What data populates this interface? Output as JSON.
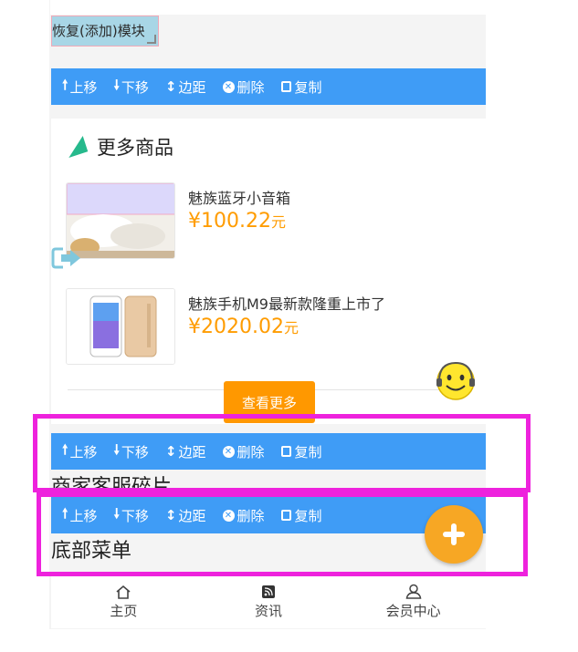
{
  "restore_module": {
    "label": "恢复(添加)模块"
  },
  "toolbar": {
    "up": "上移",
    "down": "下移",
    "margin": "边距",
    "delete": "删除",
    "copy": "复制"
  },
  "more_goods": {
    "title": "更多商品",
    "products": [
      {
        "name": "魅族蓝牙小音箱",
        "price": "¥100.22",
        "unit": "元"
      },
      {
        "name": "魅族手机M9最新款隆重上市了",
        "price": "¥2020.02",
        "unit": "元"
      }
    ],
    "more_button": "查看更多"
  },
  "sections": {
    "merchant_service": "商家客服碎片",
    "bottom_menu": "底部菜单"
  },
  "footer": {
    "items": [
      {
        "label": "主页",
        "icon": "home-icon"
      },
      {
        "label": "资讯",
        "icon": "rss-icon"
      },
      {
        "label": "会员中心",
        "icon": "user-icon"
      }
    ]
  },
  "colors": {
    "toolbar_bg": "#3f9cf6",
    "price": "#ff9c00",
    "highlight": "#ee22dd",
    "fab": "#f7a724"
  }
}
